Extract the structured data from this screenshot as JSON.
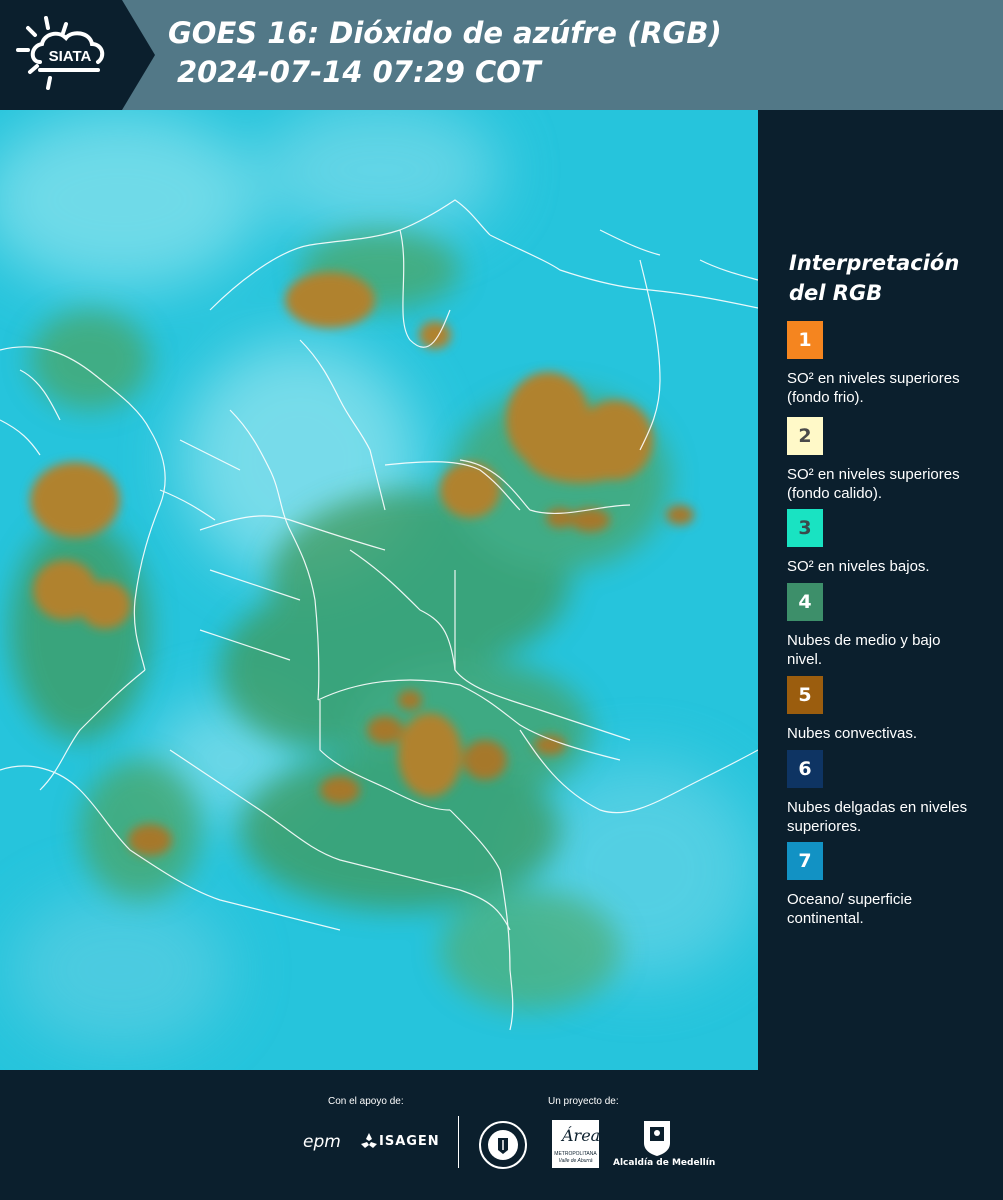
{
  "header": {
    "logo_text": "SIATA",
    "title_line1": "GOES 16: Dióxido de azúfre (RGB)",
    "title_line2": "2024-07-14 07:29 COT"
  },
  "legend": {
    "title_line1": "Interpretación",
    "title_line2": "del RGB",
    "items": [
      {
        "number": "1",
        "color": "#f5851f",
        "label": "SO² en niveles superiores (fondo frio)."
      },
      {
        "number": "2",
        "color": "#fff9c8",
        "label": "SO² en niveles superiores (fondo calido)."
      },
      {
        "number": "3",
        "color": "#19e3c2",
        "label": "SO² en niveles bajos."
      },
      {
        "number": "4",
        "color": "#3d8f6a",
        "label": "Nubes de medio y bajo nivel."
      },
      {
        "number": "5",
        "color": "#9b5d0e",
        "label": "Nubes convectivas."
      },
      {
        "number": "6",
        "color": "#0e3463",
        "label": "Nubes delgadas en niveles superiores."
      },
      {
        "number": "7",
        "color": "#1292c4",
        "label": "Oceano/ superficie continental."
      }
    ]
  },
  "footer": {
    "support_label": "Con el apoyo de:",
    "project_label": "Un proyecto de:",
    "epm_text": "epm",
    "isagen_text": "ISAGEN",
    "area_text": "Área",
    "area_subtext": "METROPOLITANA",
    "area_subtext2": "Valle de Aburrá",
    "alcaldia_text": "Alcaldía de Medellín"
  },
  "colors": {
    "header_bg": "#527887",
    "panel_bg": "#0b1f2d",
    "ocean_cyan": "#26c4dc",
    "vegetation_green": "#3f9a5c",
    "convective_brown": "#b0822e"
  }
}
